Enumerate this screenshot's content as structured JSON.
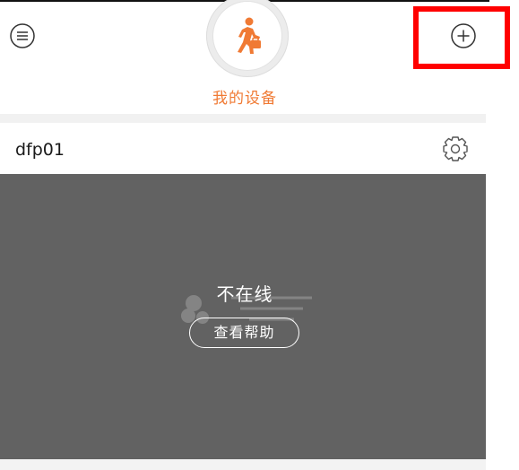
{
  "header": {
    "title": "我的设备"
  },
  "device": {
    "name": "dfp01",
    "status": "不在线",
    "help_label": "查看帮助"
  },
  "icons": {
    "menu": "menu-icon",
    "add": "plus-circle-icon",
    "avatar": "walking-person-icon",
    "settings": "gear-icon"
  },
  "colors": {
    "accent": "#f07a34",
    "screen": "#626262",
    "highlight": "#ff0000"
  }
}
